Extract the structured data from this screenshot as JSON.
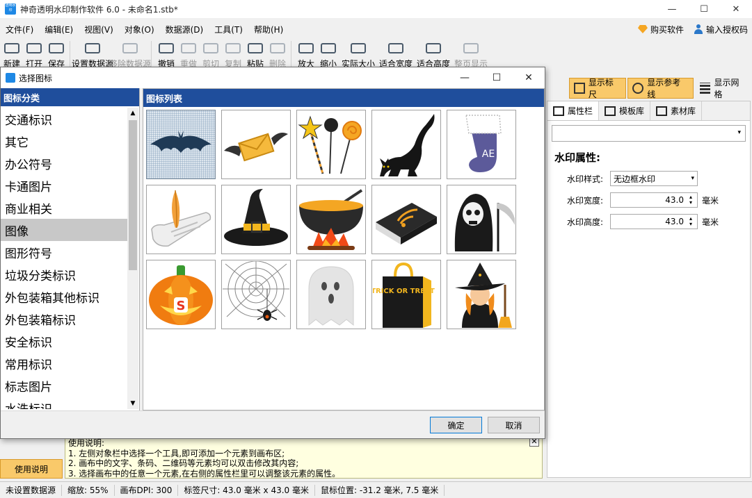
{
  "window": {
    "title": "神奇透明水印制作软件 6.0 - 未命名1.stb*",
    "app_icon_text": "透明水印",
    "controls": {
      "minimize": "—",
      "maximize": "☐",
      "close": "✕"
    }
  },
  "menubar": {
    "items": [
      "文件(F)",
      "编辑(E)",
      "视图(V)",
      "对象(O)",
      "数据源(D)",
      "工具(T)",
      "帮助(H)"
    ],
    "buy": "购买软件",
    "license": "输入授权码"
  },
  "toolbar": {
    "new": "新建",
    "open": "打开",
    "save": "保存",
    "set_datasource": "设置数据源",
    "remove_datasource": "移除数据源",
    "undo": "撤销",
    "redo": "重做",
    "cut": "剪切",
    "copy": "复制",
    "paste": "粘贴",
    "delete": "删除",
    "zoom_in": "放大",
    "zoom_out": "缩小",
    "actual_size": "实际大小",
    "fit_width": "适合宽度",
    "fit_height": "适合高度",
    "fit_page": "整页显示"
  },
  "view_toggles": {
    "ruler": "显示标尺",
    "guides": "显示参考线",
    "grid": "显示网格"
  },
  "properties": {
    "tabs": [
      "属性栏",
      "模板库",
      "素材库"
    ],
    "heading": "水印属性:",
    "style_label": "水印样式:",
    "style_value": "无边框水印",
    "width_label": "水印宽度:",
    "width_value": "43.0",
    "height_label": "水印高度:",
    "height_value": "43.0",
    "unit": "毫米"
  },
  "instructions": {
    "button": "使用说明",
    "lines": [
      "使用说明:",
      "1. 左侧对象栏中选择一个工具,即可添加一个元素到画布区;",
      "2. 画布中的文字、条码、二维码等元素均可以双击修改其内容;",
      "3. 选择画布中的任意一个元素,在右侧的属性栏里可以调整该元素的属性。"
    ],
    "close": "✕"
  },
  "statusbar": {
    "datasource": "未设置数据源",
    "zoom": "缩放: 55%",
    "dpi": "画布DPI: 300",
    "label_size": "标签尺寸: 43.0 毫米 x 43.0 毫米",
    "mouse_pos": "鼠标位置: -31.2 毫米, 7.5 毫米"
  },
  "dialog": {
    "title": "选择图标",
    "category_header": "图标分类",
    "categories": [
      "交通标识",
      "其它",
      "办公符号",
      "卡通图片",
      "商业相关",
      "图像",
      "图形符号",
      "垃圾分类标识",
      "外包装箱其他标识",
      "外包装箱标识",
      "安全标识",
      "常用标识",
      "标志图片",
      "水洗标识"
    ],
    "selected_category": "图像",
    "icon_header": "图标列表",
    "icons": [
      {
        "name": "bat-icon"
      },
      {
        "name": "flying-envelope-icon"
      },
      {
        "name": "candy-wands-icon"
      },
      {
        "name": "black-cat-icon"
      },
      {
        "name": "christmas-stocking-icon",
        "text": "AE"
      },
      {
        "name": "quill-scroll-icon"
      },
      {
        "name": "witch-hat-icon"
      },
      {
        "name": "cauldron-icon"
      },
      {
        "name": "rss-book-icon"
      },
      {
        "name": "grim-reaper-icon"
      },
      {
        "name": "pumpkin-icon",
        "text": "S"
      },
      {
        "name": "spider-web-icon"
      },
      {
        "name": "ghost-icon"
      },
      {
        "name": "trick-or-treat-bag-icon",
        "text": "TRICK OR TREAT"
      },
      {
        "name": "witch-icon"
      }
    ],
    "ok": "确定",
    "cancel": "取消",
    "controls": {
      "minimize": "—",
      "maximize": "☐",
      "close": "✕"
    }
  },
  "colors": {
    "panel_header": "#1f4e9c",
    "toggle_active": "#f9c96a",
    "selection": "#c8c8c8"
  }
}
